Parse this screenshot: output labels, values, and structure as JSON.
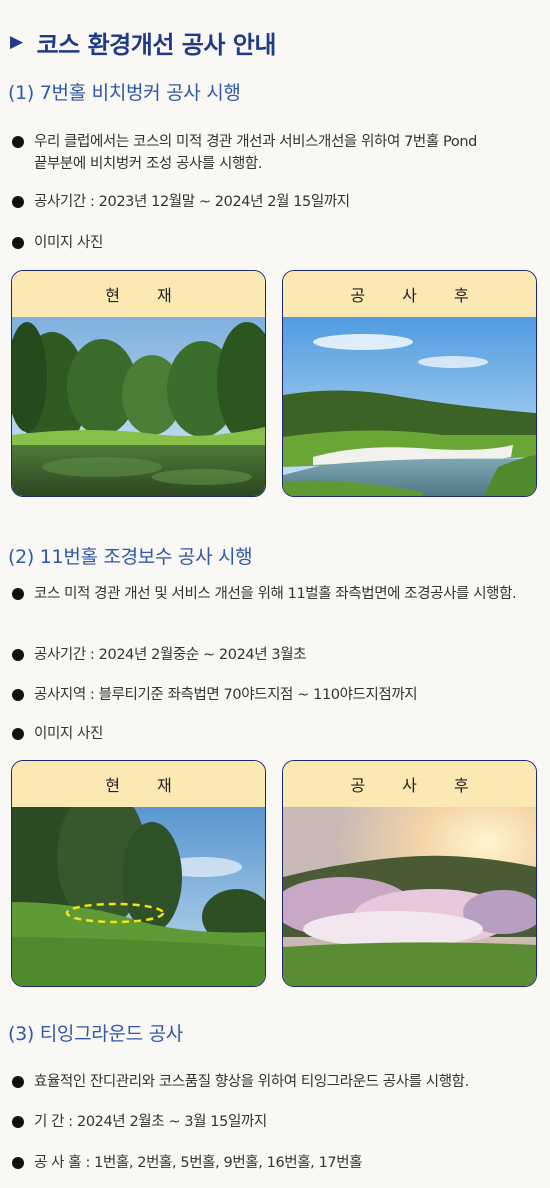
{
  "main_title": "코스 환경개선 공사 안내",
  "sections": [
    {
      "title": "(1) 7번홀 비치벙커 공사 시행",
      "bullets": [
        "우리 클럽에서는 코스의 미적 경관 개선과 서비스개선을 위하여 7번홀 Pond 끝부분에 비치벙커 조성 공사를 시행함.",
        "공사기간 : 2023년 12월말 ~ 2024년 2월 15일까지",
        "이미지 사진"
      ],
      "before_label": "현 재",
      "after_label": "공 사 후"
    },
    {
      "title": "(2) 11번홀 조경보수 공사 시행",
      "bullets": [
        "코스 미적 경관 개선 및 서비스 개선을 위해 11벌홀 좌측법면에 조경공사를 시행함.",
        "공사기간 : 2024년 2월중순 ~ 2024년 3월초",
        "공사지역 : 블루티기준 좌측법면 70야드지점 ~ 110야드지점까지",
        "이미지 사진"
      ],
      "before_label": "현 재",
      "after_label": "공 사 후"
    },
    {
      "title": "(3) 티잉그라운드 공사",
      "bullets": [
        "효율적인 잔디관리와 코스품질 향상을 위하여 티잉그라운드 공사를 시행함.",
        "기 간 : 2024년 2월초 ~ 3월 15일까지",
        "공 사 홀 : 1번홀, 2번홀, 5번홀, 9번홀, 16번홀, 17번홀"
      ]
    }
  ],
  "colors": {
    "title": "#1f3a86",
    "section_title": "#2f58a8",
    "card_label_bg": "#fce8b2",
    "card_border": "#1e2770"
  }
}
